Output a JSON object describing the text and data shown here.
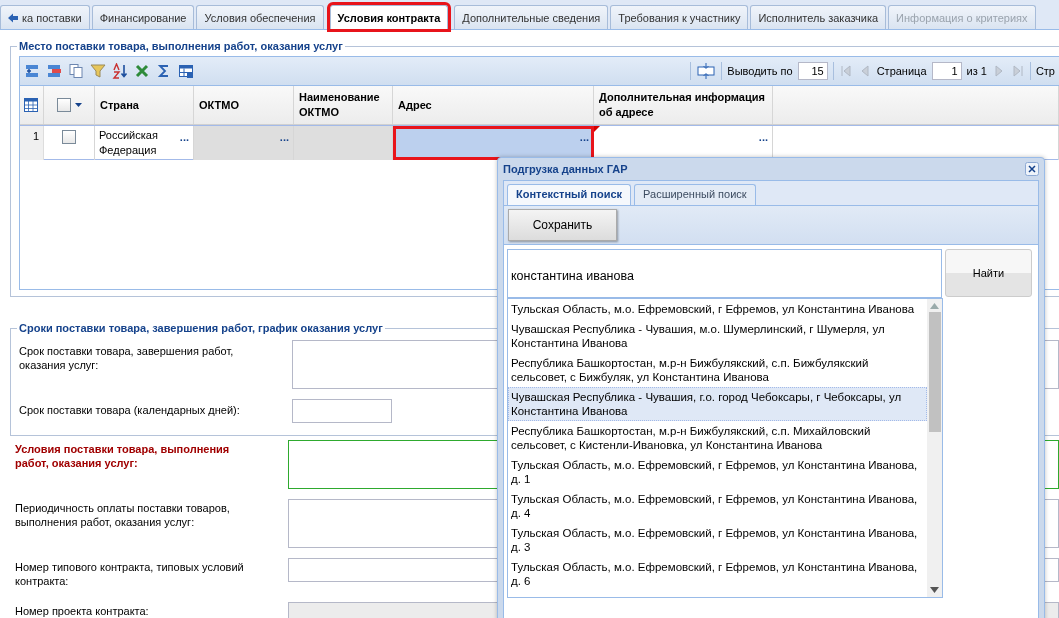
{
  "tabs": [
    {
      "label": "ка поставки",
      "kind": "back",
      "selected": false,
      "disabled": false,
      "highlighted": false
    },
    {
      "label": "Финансирование",
      "kind": "plain",
      "selected": false,
      "disabled": false,
      "highlighted": false
    },
    {
      "label": "Условия обеспечения",
      "kind": "plain",
      "selected": false,
      "disabled": false,
      "highlighted": false
    },
    {
      "label": "Условия контракта",
      "kind": "plain",
      "selected": true,
      "disabled": false,
      "highlighted": true
    },
    {
      "label": "Дополнительные сведения",
      "kind": "plain",
      "selected": false,
      "disabled": false,
      "highlighted": false
    },
    {
      "label": "Требования к участнику",
      "kind": "plain",
      "selected": false,
      "disabled": false,
      "highlighted": false
    },
    {
      "label": "Исполнитель заказчика",
      "kind": "plain",
      "selected": false,
      "disabled": false,
      "highlighted": false
    },
    {
      "label": "Информация о критериях",
      "kind": "plain",
      "selected": false,
      "disabled": true,
      "highlighted": false
    }
  ],
  "delivery_place": {
    "title": "Место поставки товара, выполнения работ, оказания услуг",
    "select_all_checked": false,
    "pager": {
      "page_size_label": "Выводить по",
      "page_size": "15",
      "page_label": "Страница",
      "page": "1",
      "of_label": "из 1",
      "cut_label": "Стр"
    },
    "columns": [
      {
        "label": "Страна"
      },
      {
        "label": "ОКТМО"
      },
      {
        "label": "Наименование ОКТМО"
      },
      {
        "label": "Адрес"
      },
      {
        "label": "Дополнительная информация об адресе"
      }
    ],
    "rows": [
      {
        "number": "1",
        "checked": false,
        "cells": [
          {
            "value": "Российская Федерация",
            "button": "...",
            "readonly": false,
            "selected": false,
            "highlighted": false,
            "modified": false
          },
          {
            "button": "...",
            "readonly": true,
            "selected": false,
            "highlighted": false,
            "modified": false
          },
          {
            "readonly": true,
            "selected": false,
            "highlighted": false,
            "modified": false
          },
          {
            "button": "...",
            "readonly": false,
            "selected": true,
            "highlighted": true,
            "modified": false
          },
          {
            "button": "...",
            "readonly": false,
            "selected": false,
            "highlighted": false,
            "modified": true
          }
        ]
      }
    ]
  },
  "terms": {
    "title": "Сроки поставки товара, завершения работ, график оказания услуг",
    "fields": [
      {
        "label": "Срок поставки товара, завершения работ, оказания услуг:",
        "kind": "textarea",
        "required": false,
        "valid": false,
        "readonly": false
      },
      {
        "label": "Срок поставки товара (календарных дней):",
        "kind": "short",
        "required": false,
        "valid": false,
        "readonly": false
      }
    ]
  },
  "conditions": [
    {
      "label": "Условия поставки товара, выполнения работ, оказания услуг:",
      "kind": "textarea",
      "required": true,
      "valid": true,
      "readonly": false
    },
    {
      "label": "Периодичность оплаты поставки товаров, выполнения работ, оказания услуг:",
      "kind": "textarea",
      "required": false,
      "valid": false,
      "readonly": false
    },
    {
      "label": "Номер типового контракта, типовых условий контракта:",
      "kind": "input",
      "required": false,
      "valid": false,
      "readonly": false
    },
    {
      "label": "Номер проекта контракта:",
      "kind": "input",
      "required": false,
      "valid": false,
      "readonly": true
    }
  ],
  "dialog": {
    "title": "Подгрузка данных ГАР",
    "tabs": [
      {
        "label": "Контекстный поиск",
        "selected": true
      },
      {
        "label": "Расширенный поиск",
        "selected": false
      }
    ],
    "save_button": "Сохранить",
    "search": {
      "value": "константина иванова"
    },
    "find_button": "Найти",
    "results": [
      {
        "text": "Тульская Область, м.о. Ефремовский, г Ефремов, ул Константина Иванова",
        "selected": false
      },
      {
        "text": "Чувашская Республика - Чувашия, м.о. Шумерлинский, г Шумерля, ул Константина Иванова",
        "selected": false
      },
      {
        "text": "Республика Башкортостан, м.р-н Бижбулякский, с.п. Бижбулякский сельсовет, с Бижбуляк, ул Константина Иванова",
        "selected": false
      },
      {
        "text": "Чувашская Республика - Чувашия, г.о. город Чебоксары, г Чебоксары, ул Константина Иванова",
        "selected": true
      },
      {
        "text": "Республика Башкортостан, м.р-н Бижбулякский, с.п. Михайловский сельсовет, с Кистенли-Ивановка, ул Константина Иванова",
        "selected": false
      },
      {
        "text": "Тульская Область, м.о. Ефремовский, г Ефремов, ул Константина Иванова, д. 1",
        "selected": false
      },
      {
        "text": "Тульская Область, м.о. Ефремовский, г Ефремов, ул Константина Иванова, д. 4",
        "selected": false
      },
      {
        "text": "Тульская Область, м.о. Ефремовский, г Ефремов, ул Константина Иванова, д. 3",
        "selected": false
      },
      {
        "text": "Тульская Область, м.о. Ефремовский, г Ефремов, ул Константина Иванова, д. 6",
        "selected": false
      }
    ]
  }
}
